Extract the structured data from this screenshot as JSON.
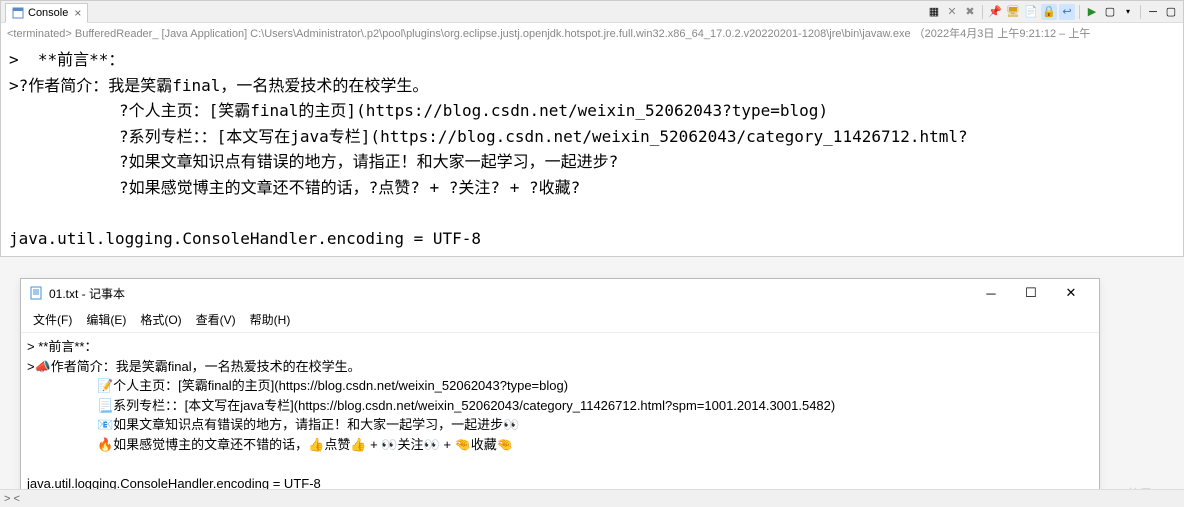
{
  "console": {
    "tab_label": "Console",
    "toolbar": {
      "icons": [
        "grid-icon",
        "remove-icon",
        "remove-all-icon",
        "sep",
        "pin-icon",
        "display-icon",
        "scroll-lock-icon",
        "word-wrap-icon",
        "sep",
        "terminate-icon",
        "open-console-icon",
        "dropdown-icon",
        "sep",
        "minimize-icon",
        "maximize-icon"
      ]
    },
    "terminated": "<terminated> BufferedReader_ [Java Application] C:\\Users\\Administrator\\.p2\\pool\\plugins\\org.eclipse.justj.openjdk.hotspot.jre.full.win32.x86_64_17.0.2.v20220201-1208\\jre\\bin\\javaw.exe （2022年4月3日 上午9:21:12 – 上午",
    "lines": {
      "l1": ">  **前言**：",
      "l2": ">?作者简介：我是笑霸final，一名热爱技术的在校学生。",
      "l3": "?个人主页：[笑霸final的主页](https://blog.csdn.net/weixin_52062043?type=blog)",
      "l4": "?系列专栏：：[本文写在java专栏](https://blog.csdn.net/weixin_52062043/category_11426712.html?",
      "l5": "?如果文章知识点有错误的地方，请指正！和大家一起学习，一起进步?",
      "l6": "?如果感觉博主的文章还不错的话，?点赞? + ?关注? + ?收藏?",
      "l7": " ",
      "l8": "java.util.logging.ConsoleHandler.encoding = UTF-8"
    }
  },
  "notepad": {
    "title": "01.txt - 记事本",
    "menu": {
      "file": "文件(F)",
      "edit": "编辑(E)",
      "format": "格式(O)",
      "view": "查看(V)",
      "help": "帮助(H)"
    },
    "lines": {
      "n1": "> **前言**：",
      "n2": ">📣作者简介：我是笑霸final，一名热爱技术的在校学生。",
      "n3": "📝个人主页：[笑霸final的主页](https://blog.csdn.net/weixin_52062043?type=blog)",
      "n4": "📃系列专栏：：[本文写在java专栏](https://blog.csdn.net/weixin_52062043/category_11426712.html?spm=1001.2014.3001.5482)",
      "n5": "📧如果文章知识点有错误的地方，请指正！和大家一起学习，一起进步👀",
      "n6": "🔥如果感觉博主的文章还不错的话，👍点赞👍 + 👀关注👀 + 🤏收藏🤏",
      "n7": " ",
      "n8": "java.util.logging.ConsoleHandler.encoding = UTF-8"
    }
  },
  "watermark": "CSDN @笑霸final",
  "bottom": "> <"
}
